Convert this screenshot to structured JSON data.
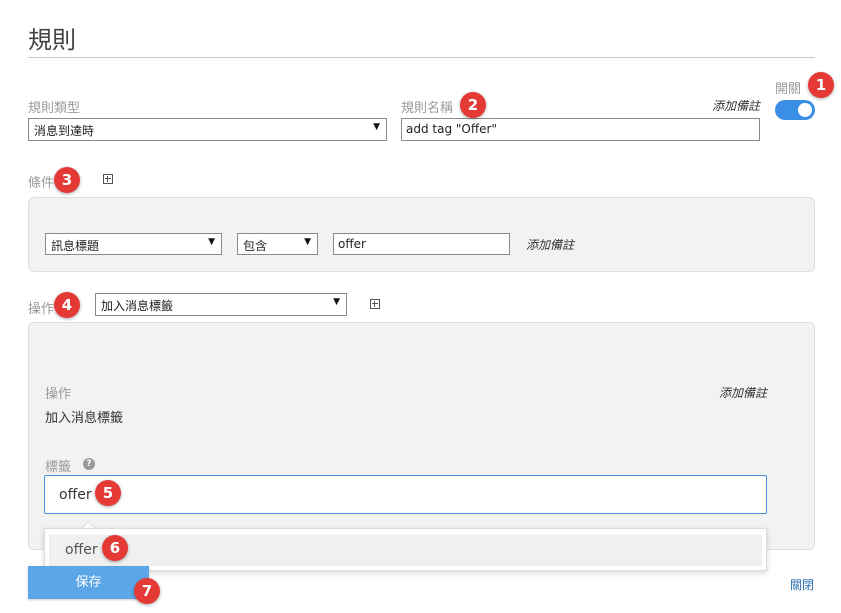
{
  "page": {
    "title": "規則"
  },
  "rule": {
    "type_label": "規則類型",
    "type_value": "消息到達時",
    "name_label": "規則名稱",
    "name_value": "add tag \"Offer\"",
    "add_note": "添加備註",
    "enabled_label": "開關",
    "enabled": true
  },
  "conditions": {
    "label": "條件",
    "field": "訊息標題",
    "operator": "包含",
    "value": "offer",
    "add_note": "添加備註"
  },
  "actions": {
    "label": "操作",
    "selected": "加入消息標籤",
    "panel": {
      "action_label": "操作",
      "action_value": "加入消息標籤",
      "add_note": "添加備註",
      "tags_label": "標籤",
      "help_glyph": "?",
      "tags_value": "offer",
      "suggestion": "offer"
    }
  },
  "footer": {
    "save_label": "保存",
    "close_label": "關閉"
  },
  "badges": [
    "1",
    "2",
    "3",
    "4",
    "5",
    "6",
    "7"
  ],
  "colors": {
    "accent": "#3a8ee6",
    "badge": "#e53935",
    "save": "#5aa6e6",
    "panel": "#f2f2f2"
  }
}
